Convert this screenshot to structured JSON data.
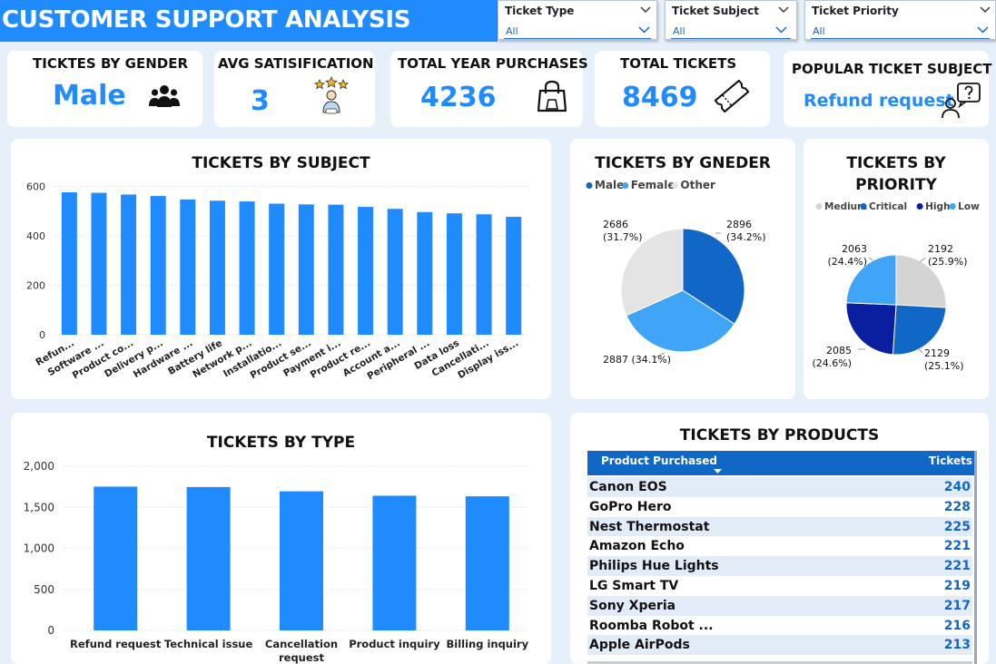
{
  "header": {
    "title": "CUSTOMER SUPPORT ANALYSIS"
  },
  "slicers": [
    {
      "label": "Ticket Type",
      "value": "All"
    },
    {
      "label": "Ticket Subject",
      "value": "All"
    },
    {
      "label": "Ticket Priority",
      "value": "All"
    }
  ],
  "kpis": {
    "gender": {
      "label": "TICKTES BY GENDER",
      "value": "Male",
      "icon": "people-icon"
    },
    "satisfaction": {
      "label": "AVG SATISIFICATION",
      "value": "3",
      "icon": "rating-stars-icon"
    },
    "purchases": {
      "label": "TOTAL YEAR PURCHASES",
      "value": "4236",
      "icon": "shopping-bag-icon"
    },
    "tickets": {
      "label": "TOTAL TICKETS",
      "value": "8469",
      "icon": "ticket-icon"
    },
    "popular": {
      "label": "POPULAR TICKET SUBJECT",
      "value": "Refund request",
      "icon": "person-question-icon"
    }
  },
  "colors": {
    "accent": "#1f8bff",
    "dark_blue": "#1167c6",
    "navy": "#0a1fa0",
    "light_blue": "#41a5f7",
    "grey": "#d9d9d9",
    "background": "#e6f0fb"
  },
  "chart_data": [
    {
      "id": "subject",
      "type": "bar",
      "title": "TICKETS BY SUBJECT",
      "categories": [
        "Refun...",
        "Software ...",
        "Product co...",
        "Delivery p...",
        "Hardware ...",
        "Battery life",
        "Network p...",
        "Installatio...",
        "Product se...",
        "Payment i...",
        "Product re...",
        "Account a...",
        "Peripheral ...",
        "Data loss",
        "Cancellati...",
        "Display iss..."
      ],
      "values": [
        576,
        574,
        567,
        561,
        547,
        542,
        539,
        530,
        527,
        526,
        517,
        509,
        496,
        491,
        487,
        477
      ],
      "yticks": [
        "0",
        "200",
        "400",
        "600"
      ],
      "ylim": [
        0,
        620
      ]
    },
    {
      "id": "type",
      "type": "bar",
      "title": "TICKETS BY TYPE",
      "categories": [
        "Refund request",
        "Technical issue",
        "Cancellation request",
        "Product inquiry",
        "Billing inquiry"
      ],
      "values": [
        1752,
        1747,
        1695,
        1641,
        1634
      ],
      "yticks": [
        "0",
        "500",
        "1,000",
        "1,500",
        "2,000"
      ],
      "ylim": [
        0,
        2000
      ]
    },
    {
      "id": "gender",
      "type": "pie",
      "title": "TICKETS BY GNEDER",
      "legend": [
        "Male",
        "Female",
        "Other"
      ],
      "slices": [
        {
          "name": "Male",
          "value": 2896,
          "label": "2896",
          "pct": "(34.2%)",
          "color": "#1167c6"
        },
        {
          "name": "Female",
          "value": 2887,
          "label": "2887 (34.1%)",
          "pct": "",
          "color": "#41a5f7"
        },
        {
          "name": "Other",
          "value": 2686,
          "label": "2686",
          "pct": "(31.7%)",
          "color": "#e4e4e4"
        }
      ]
    },
    {
      "id": "priority",
      "type": "pie",
      "title_line1": "TICKETS BY",
      "title_line2": "PRIORITY",
      "legend": [
        "Medium",
        "Critical",
        "High",
        "Low"
      ],
      "slices": [
        {
          "name": "Medium",
          "value": 2192,
          "label": "2192",
          "pct": "(25.9%)",
          "color": "#d4d4d4"
        },
        {
          "name": "Critical",
          "value": 2129,
          "label": "2129",
          "pct": "(25.1%)",
          "color": "#1167c6"
        },
        {
          "name": "High",
          "value": 2085,
          "label": "2085",
          "pct": "(24.6%)",
          "color": "#0a1fa0"
        },
        {
          "name": "Low",
          "value": 2063,
          "label": "2063",
          "pct": "(24.4%)",
          "color": "#41a5f7"
        }
      ]
    },
    {
      "id": "products",
      "type": "table",
      "title": "TICKETS BY PRODUCTS",
      "columns": [
        "Product Purchased",
        "Tickets"
      ],
      "rows": [
        [
          "Canon EOS",
          "240"
        ],
        [
          "GoPro Hero",
          "228"
        ],
        [
          "Nest Thermostat",
          "225"
        ],
        [
          "Amazon Echo",
          "221"
        ],
        [
          "Philips Hue Lights",
          "221"
        ],
        [
          "LG Smart TV",
          "219"
        ],
        [
          "Sony Xperia",
          "217"
        ],
        [
          "Roomba Robot ...",
          "216"
        ],
        [
          "Apple AirPods",
          "213"
        ]
      ]
    }
  ]
}
